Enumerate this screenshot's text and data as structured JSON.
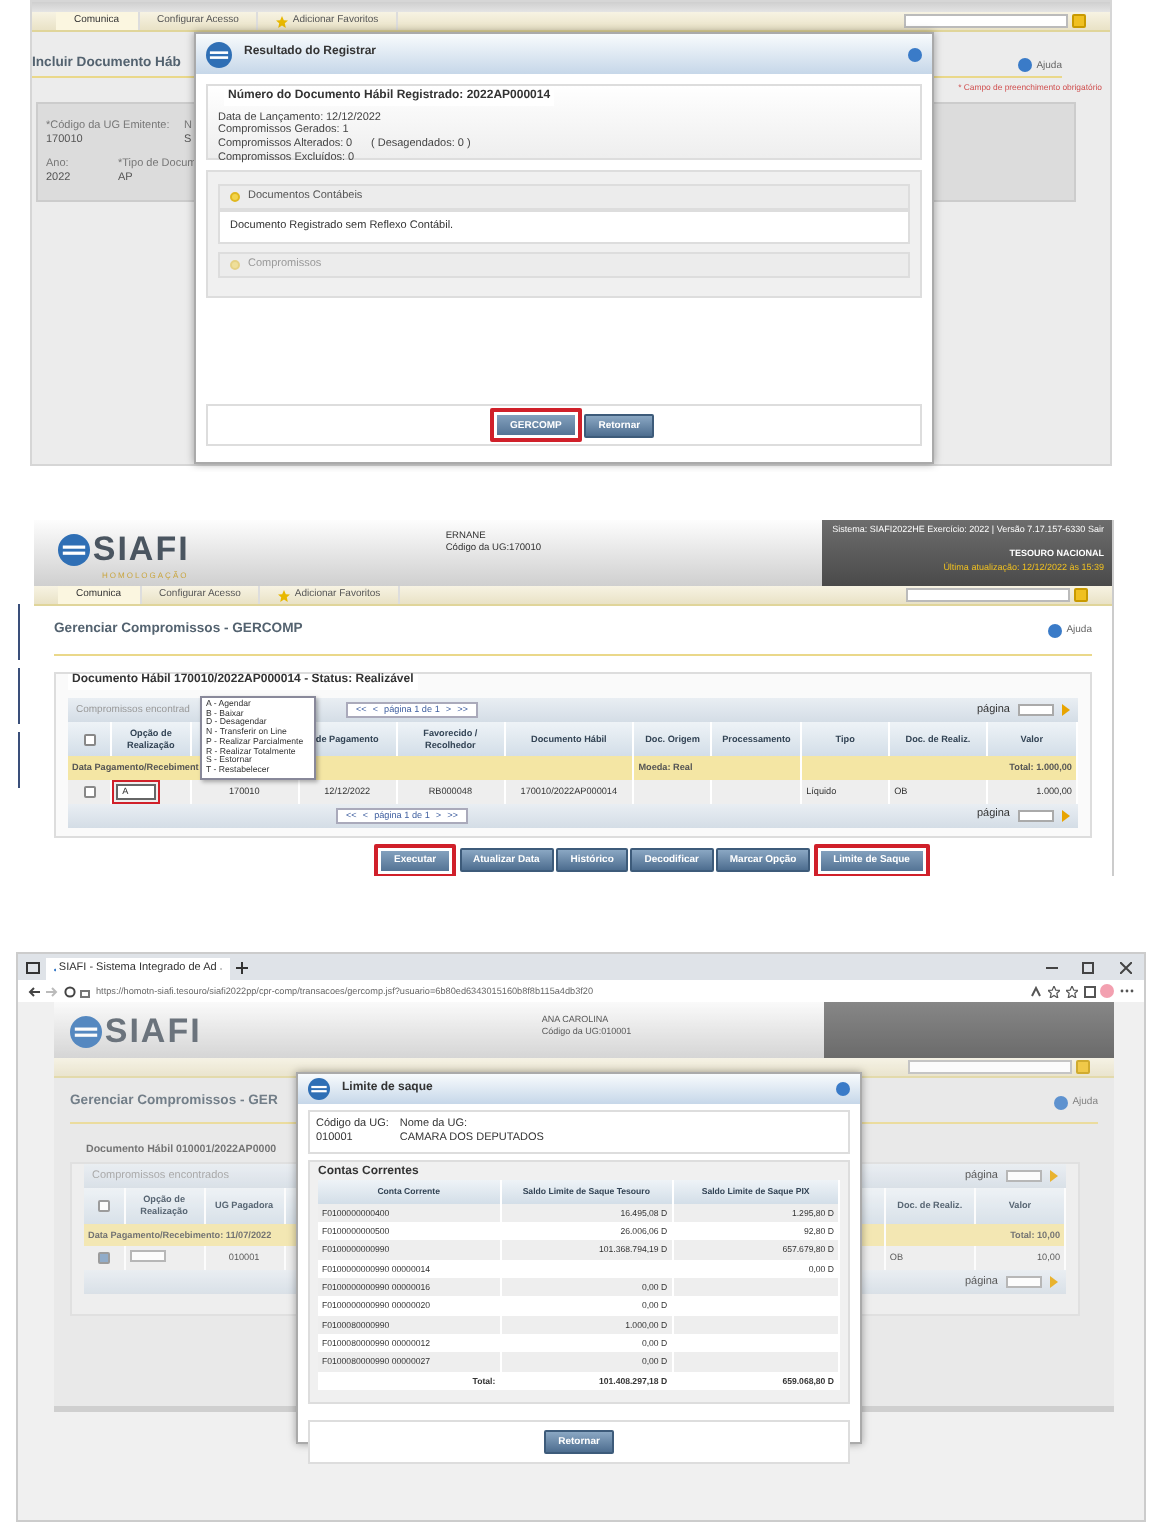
{
  "register_screen": {
    "tabs": [
      {
        "label": "Comunica",
        "selected": true,
        "kind": "link"
      },
      {
        "label": "Configurar Acesso",
        "selected": false,
        "kind": "link"
      },
      {
        "label": "Adicionar Favoritos",
        "selected": false,
        "kind": "favorite"
      }
    ],
    "page_title": "Incluir Documento Háb",
    "help": "Ajuda",
    "required_note": "* Campo de preenchimento obrigatório",
    "form_fields": [
      {
        "label": "*Código da UG Emitente:",
        "value": "170010"
      },
      {
        "label": "N",
        "value": "S"
      },
      {
        "label": "Ano:",
        "value": "2022"
      },
      {
        "label": "*Tipo de Docum",
        "value": "AP"
      }
    ],
    "dialog": {
      "title": "Resultado do Registrar",
      "legend": "Número do Documento Hábil Registrado: 2022AP000014",
      "details": [
        {
          "label": "Data de Lançamento:",
          "value": "12/12/2022"
        },
        {
          "label": "Compromissos Gerados:",
          "value": "1"
        },
        {
          "label": "Compromissos Alterados:",
          "value": "0",
          "note": "( Desagendados: 0 )"
        },
        {
          "label": "Compromissos Excluídos:",
          "value": "0"
        }
      ],
      "sections": [
        {
          "title": "Documentos Contábeis",
          "expanded": true,
          "content": "Documento Registrado sem Reflexo Contábil."
        },
        {
          "title": "Compromissos",
          "expanded": false
        }
      ],
      "buttons": [
        {
          "label": "GERCOMP",
          "highlighted": true
        },
        {
          "label": "Retornar",
          "highlighted": false
        }
      ]
    }
  },
  "gercomp_screen": {
    "header": {
      "logo": "SIAFI",
      "environment": "HOMOLOGAÇÃO",
      "user": "ERNANE",
      "ug": "Código da UG:170010",
      "system_info": "Sistema: SIAFI2022HE Exercício: 2022 | Versão 7.17.157-6330",
      "logout": "Sair",
      "org": "TESOURO NACIONAL",
      "updated": "Última atualização: 12/12/2022 às 15:39"
    },
    "tabs": [
      {
        "label": "Comunica",
        "selected": true,
        "kind": "link"
      },
      {
        "label": "Configurar Acesso",
        "selected": false,
        "kind": "link"
      },
      {
        "label": "Adicionar Favoritos",
        "selected": false,
        "kind": "favorite"
      }
    ],
    "page_title": "Gerenciar Compromissos - GERCOMP",
    "help": "Ajuda",
    "legend": "Documento Hábil 170010/2022AP000014 - Status: Realizável",
    "caption": "Compromissos encontrad",
    "pagers": [
      {
        "first": "<<",
        "prev": "<",
        "label": "página 1 de 1",
        "next": ">",
        "last": ">>",
        "page_label": "página"
      },
      {
        "first": "<<",
        "prev": "<",
        "label": "página 1 de 1",
        "next": ">",
        "last": ">>",
        "page_label": "página"
      }
    ],
    "select_all_checked": false,
    "columns": [
      "Opção de Realização",
      "de Pagamento",
      "Favorecido / Recolhedor",
      "Documento Hábil",
      "Doc. Origem",
      "Processamento",
      "Tipo",
      "Doc. de Realiz.",
      "Valor"
    ],
    "group": {
      "label": "Data Pagamento/Recebiment",
      "currency": "Moeda: Real",
      "total": "Total: 1.000,00"
    },
    "rows": [
      {
        "checked": false,
        "option": "A",
        "ug": "170010",
        "date": "12/12/2022",
        "payee": "RB000048",
        "document": "170010/2022AP000014",
        "type": "Líquido",
        "realization_doc": "OB",
        "value": "1.000,00"
      }
    ],
    "option_menu": [
      "A - Agendar",
      "B - Baixar",
      "D - Desagendar",
      "N - Transferir on Line",
      "P - Realizar Parcialmente",
      "R - Realizar Totalmente",
      "S - Estornar",
      "T - Restabelecer"
    ],
    "buttons": [
      {
        "label": "Executar",
        "highlighted": true
      },
      {
        "label": "Atualizar Data",
        "highlighted": false
      },
      {
        "label": "Histórico",
        "highlighted": false
      },
      {
        "label": "Decodificar",
        "highlighted": false
      },
      {
        "label": "Marcar Opção",
        "highlighted": false
      },
      {
        "label": "Limite de Saque",
        "highlighted": true
      }
    ]
  },
  "limit_screen": {
    "browser": {
      "tab_title": "SIAFI - Sistema Integrado de Ad",
      "url": "https://homotn-siafi.tesouro/siafi2022pp/cpr-comp/transacoes/gercomp.jsf?usuario=6b80ed6343015160b8f8b115a4db3f20"
    },
    "header": {
      "logo": "SIAFI",
      "user": "ANA CAROLINA",
      "ug": "Código da UG:010001"
    },
    "page_title": "Gerenciar Compromissos - GER",
    "legend": "Documento Hábil 010001/2022AP0000",
    "caption": "Compromissos encontrados",
    "select_all_checked": false,
    "columns_left": [
      "Opção de Realização",
      "UG Pagadora"
    ],
    "columns_right": [
      "Doc. de Realiz.",
      "Valor"
    ],
    "group": {
      "label": "Data Pagamento/Recebimento: 11/07/2022",
      "total": "Total: 10,00"
    },
    "row": {
      "checked": true,
      "ug": "010001",
      "realization_doc": "OB",
      "value": "10,00"
    },
    "pagers": [
      {
        "page_label": "página"
      },
      {
        "page_label": "página"
      }
    ],
    "help": "Ajuda",
    "dialog": {
      "title": "Limite de saque",
      "ug_code_label": "Código da UG:",
      "ug_code": "010001",
      "ug_name_label": "Nome da UG:",
      "ug_name": "CAMARA DOS DEPUTADOS",
      "section": "Contas Correntes",
      "columns": [
        "Conta Corrente",
        "Saldo Limite de Saque Tesouro",
        "Saldo Limite de Saque PIX"
      ],
      "rows": [
        {
          "account": "F0100000000400",
          "treasury": "16.495,08 D",
          "other": "1.295,80 D"
        },
        {
          "account": "F0100000000500",
          "treasury": "26.006,06 D",
          "other": "92,80 D"
        },
        {
          "account": "F0100000000990",
          "treasury": "101.368.794,19 D",
          "other": "657.679,80 D"
        },
        {
          "account": "F0100000000990 00000014",
          "other": "0,00 D"
        },
        {
          "account": "F0100000000990 00000016",
          "treasury": "0,00 D"
        },
        {
          "account": "F0100000000990 00000020",
          "treasury": "0,00 D"
        },
        {
          "account": "F0100080000990",
          "treasury": "1.000,00 D"
        },
        {
          "account": "F0100080000990 00000012",
          "treasury": "0,00 D"
        },
        {
          "account": "F0100080000990 00000027",
          "treasury": "0,00 D"
        }
      ],
      "total_label": "Total:",
      "total_treasury": "101.408.297,18 D",
      "total_other": "659.068,80 D",
      "button": "Retornar"
    }
  }
}
